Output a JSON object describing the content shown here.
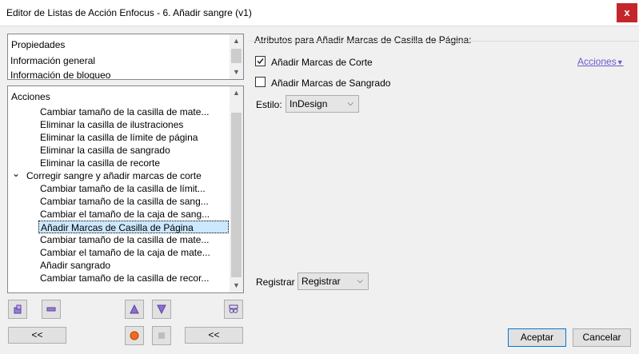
{
  "window": {
    "title": "Editor de Listas de Acción Enfocus - 6. Añadir sangre (v1)",
    "close_glyph": "x"
  },
  "properties_panel": {
    "header": "Propiedades",
    "items": [
      "Información general",
      "Información de bloqueo"
    ]
  },
  "actions_panel": {
    "header": "Acciones",
    "items": [
      {
        "label": "Cambiar tamaño de la casilla de mate...",
        "level": 2
      },
      {
        "label": "Eliminar la casilla de ilustraciones",
        "level": 2
      },
      {
        "label": "Eliminar la casilla de límite de página",
        "level": 2
      },
      {
        "label": "Eliminar la casilla de sangrado",
        "level": 2
      },
      {
        "label": "Eliminar la casilla de recorte",
        "level": 2
      },
      {
        "label": "Corregir sangre y añadir marcas de corte",
        "level": 1,
        "expanded": true
      },
      {
        "label": "Cambiar tamaño de la casilla de límit...",
        "level": 2
      },
      {
        "label": "Cambiar tamaño de la casilla de sang...",
        "level": 2
      },
      {
        "label": "Cambiar el tamaño de la caja de sang...",
        "level": 2
      },
      {
        "label": "Añadir Marcas de Casilla de Página",
        "level": 2,
        "selected": true
      },
      {
        "label": "Cambiar tamaño de la casilla de mate...",
        "level": 2
      },
      {
        "label": "Cambiar el tamaño de la caja de mate...",
        "level": 2
      },
      {
        "label": "Añadir sangrado",
        "level": 2
      },
      {
        "label": "Cambiar tamaño de la casilla de recor...",
        "level": 2
      }
    ]
  },
  "toolbar": {
    "collapse_left_label": "<<",
    "collapse_right_label": "<<"
  },
  "attributes": {
    "group_title": "Atributos para Añadir Marcas de Casilla de Página:",
    "crop_marks_label": "Añadir Marcas de Corte",
    "crop_marks_checked": true,
    "bleed_marks_label": "Añadir Marcas de Sangrado",
    "bleed_marks_checked": false,
    "actions_link": "Acciones",
    "style_label": "Estilo:",
    "style_value": "InDesign",
    "register_label": "Registrar",
    "register_value": "Registrar"
  },
  "footer": {
    "accept_label": "Aceptar",
    "cancel_label": "Cancelar"
  },
  "colors": {
    "accent": "#6a5acd",
    "selection": "#cce8ff",
    "close_red": "#c4262c"
  }
}
